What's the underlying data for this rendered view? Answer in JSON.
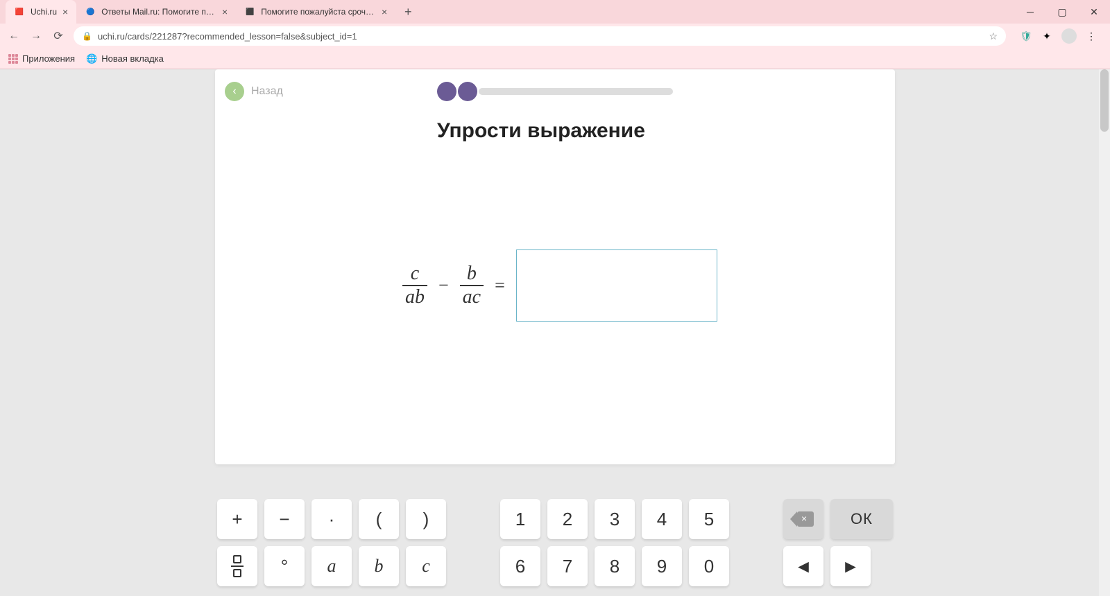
{
  "browser": {
    "tabs": [
      {
        "title": "Uchi.ru",
        "active": true
      },
      {
        "title": "Ответы Mail.ru: Помогите пожа",
        "active": false
      },
      {
        "title": "Помогите пожалуйста срочно!",
        "active": false
      }
    ],
    "url": "uchi.ru/cards/221287?recommended_lesson=false&subject_id=1",
    "bookmarks": {
      "apps": "Приложения",
      "newtab": "Новая вкладка"
    }
  },
  "card": {
    "back_label": "Назад",
    "heading": "Упрости выражение",
    "progress": {
      "filled": 2
    },
    "expression": {
      "frac1": {
        "num": "c",
        "den": "ab"
      },
      "op1": "−",
      "frac2": {
        "num": "b",
        "den": "ac"
      },
      "eq": "="
    }
  },
  "keyboard": {
    "row1": [
      "+",
      "−",
      "·",
      "(",
      ")",
      "",
      "1",
      "2",
      "3",
      "4",
      "5"
    ],
    "row2_frac": "frac",
    "row2_deg": "°",
    "row2_vars": [
      "a",
      "b",
      "c"
    ],
    "row2_nums": [
      "6",
      "7",
      "8",
      "9",
      "0"
    ],
    "ok": "ОК",
    "arrows": [
      "◄",
      "►"
    ]
  }
}
